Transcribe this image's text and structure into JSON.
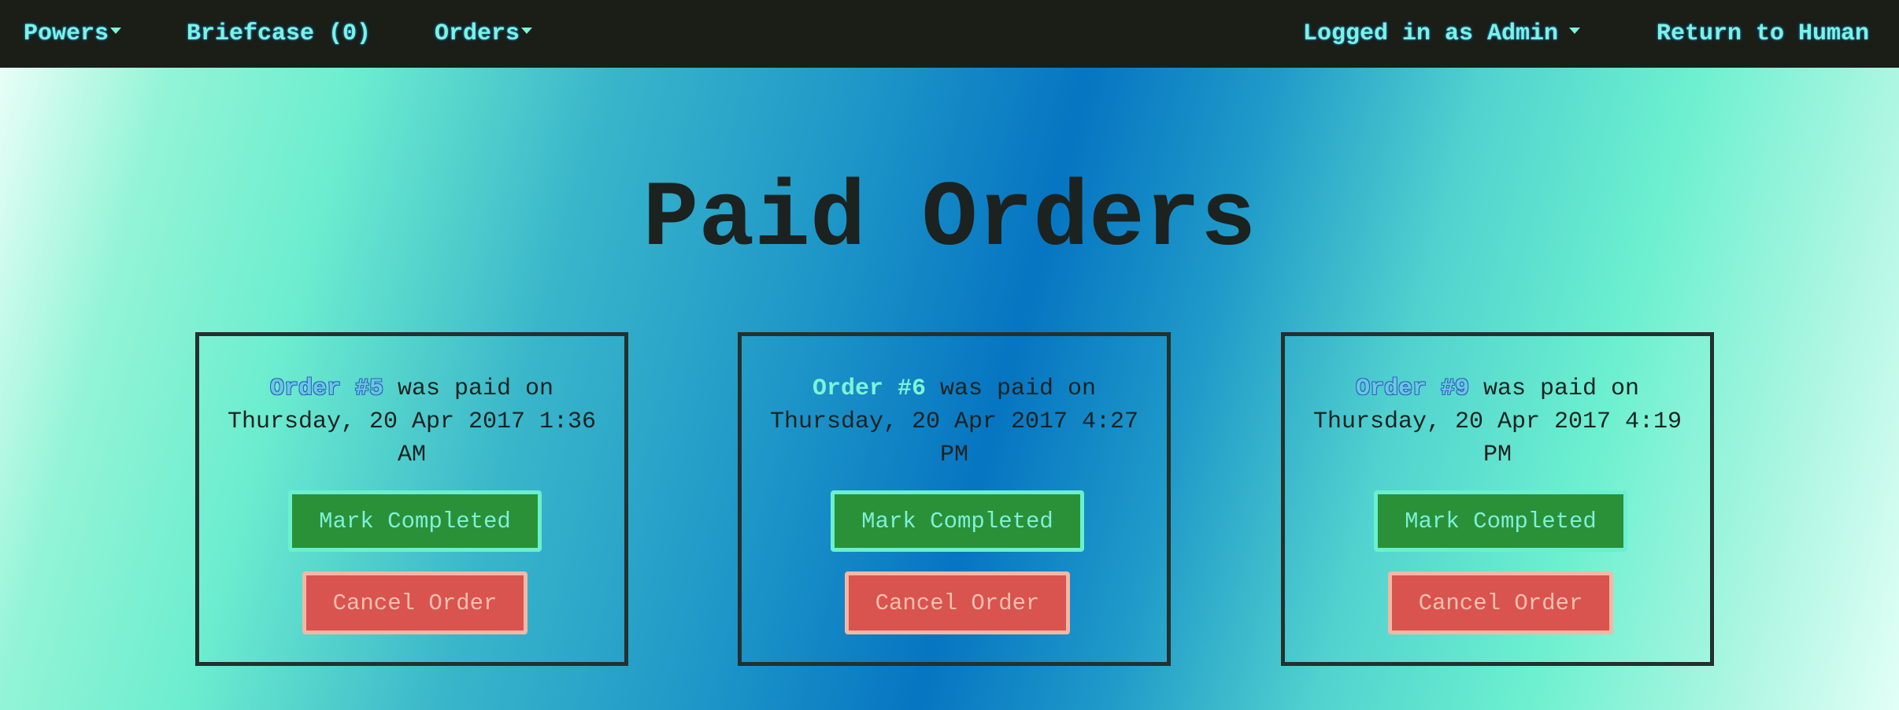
{
  "nav": {
    "powers_label": "Powers",
    "briefcase_label": "Briefcase (0)",
    "orders_label": "Orders",
    "user_label": "Logged in as Admin",
    "return_label": "Return to Human"
  },
  "page": {
    "title": "Paid Orders"
  },
  "orders": [
    {
      "link_text": "Order #5",
      "paid_text": " was paid on Thursday, 20 Apr 2017 1:36 AM",
      "complete_label": "Mark Completed",
      "cancel_label": "Cancel Order"
    },
    {
      "link_text": "Order #6",
      "paid_text": " was paid on Thursday, 20 Apr 2017 4:27 PM",
      "complete_label": "Mark Completed",
      "cancel_label": "Cancel Order"
    },
    {
      "link_text": "Order #9",
      "paid_text": " was paid on Thursday, 20 Apr 2017 4:19 PM",
      "complete_label": "Mark Completed",
      "cancel_label": "Cancel Order"
    }
  ],
  "colors": {
    "navbar_bg": "#1a1e17",
    "nav_text": "#7cf4dc",
    "complete_button": "#2a9138",
    "cancel_button": "#d9534f"
  }
}
